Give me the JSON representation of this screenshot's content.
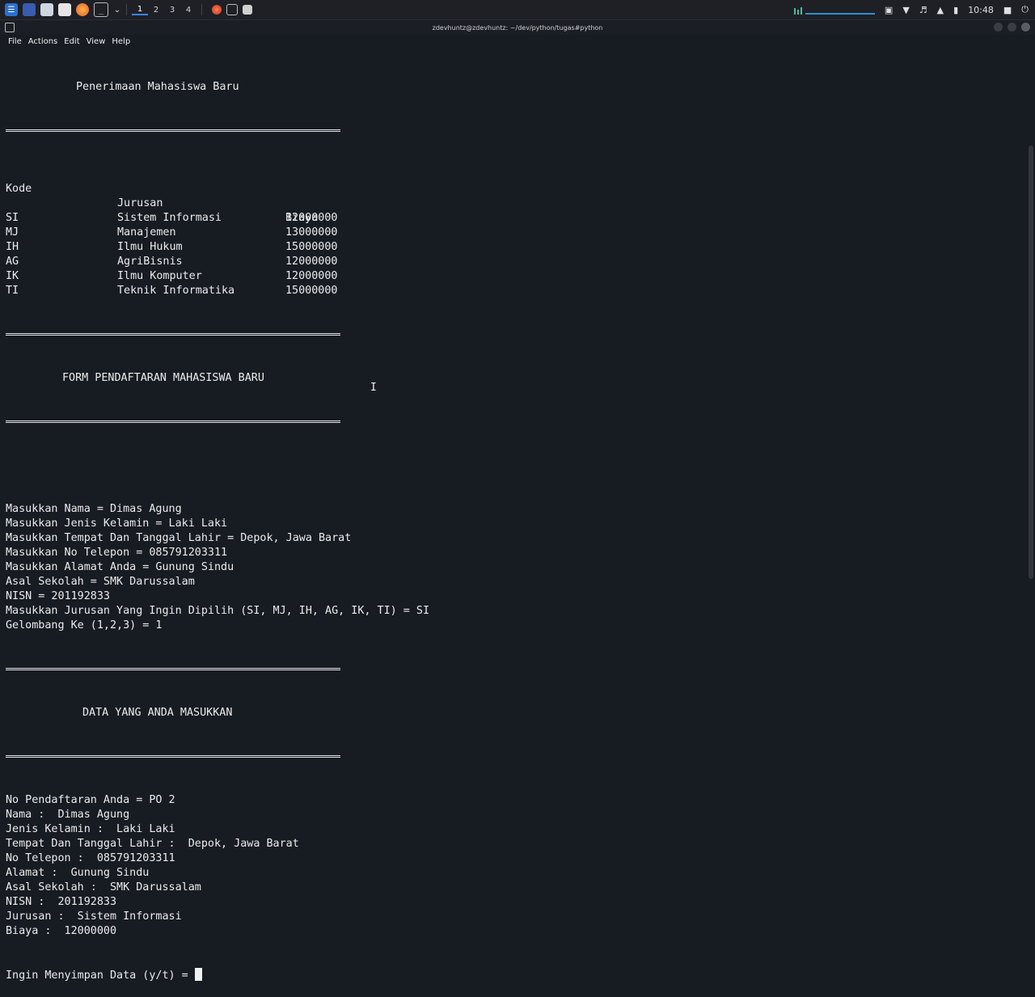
{
  "panel": {
    "workspaces": [
      "1",
      "2",
      "3",
      "4"
    ],
    "active_workspace": "1",
    "clock": "10:48",
    "icons": [
      "kali-menu-icon",
      "desktop-icon",
      "file-manager-icon",
      "text-editor-icon",
      "firefox-icon",
      "terminal-icon",
      "chevron-down-icon",
      "app-icon",
      "terminal-small-icon",
      "notes-icon",
      "network-graph-icon",
      "camera-icon",
      "network-icon",
      "volume-icon",
      "bell-icon",
      "battery-icon",
      "lock-icon",
      "power-icon"
    ]
  },
  "window": {
    "title": "zdevhuntz@zdevhuntz: ~/dev/python/tugas#python"
  },
  "menu": [
    "File",
    "Actions",
    "Edit",
    "View",
    "Help"
  ],
  "terminal": {
    "header_title": "Penerimaan Mahasiswa Baru",
    "table_headers": [
      "Kode",
      "Jurusan",
      "Biaya"
    ],
    "table_rows": [
      [
        "SI",
        "Sistem Informasi",
        "12000000"
      ],
      [
        "MJ",
        "Manajemen",
        "13000000"
      ],
      [
        "IH",
        "Ilmu Hukum",
        "15000000"
      ],
      [
        "AG",
        "AgriBisnis",
        "12000000"
      ],
      [
        "IK",
        "Ilmu Komputer",
        "12000000"
      ],
      [
        "TI",
        "Teknik Informatika",
        "15000000"
      ]
    ],
    "form_title": "FORM PENDAFTARAN MAHASISWA BARU",
    "form_lines": [
      "Masukkan Nama = Dimas Agung",
      "Masukkan Jenis Kelamin = Laki Laki",
      "Masukkan Tempat Dan Tanggal Lahir = Depok, Jawa Barat",
      "Masukkan No Telepon = 085791203311",
      "Masukkan Alamat Anda = Gunung Sindu",
      "Asal Sekolah = SMK Darussalam",
      "NISN = 201192833",
      "Masukkan Jurusan Yang Ingin Dipilih (SI, MJ, IH, AG, IK, TI) = SI",
      "Gelombang Ke (1,2,3) = 1"
    ],
    "data_title": "DATA YANG ANDA MASUKKAN",
    "data_lines": [
      "No Pendaftaran Anda = PO 2",
      "Nama :  Dimas Agung",
      "Jenis Kelamin :  Laki Laki",
      "Tempat Dan Tanggal Lahir :  Depok, Jawa Barat",
      "No Telepon :  085791203311",
      "Alamat :  Gunung Sindu",
      "Asal Sekolah :  SMK Darussalam",
      "NISN :  201192833",
      "Jurusan :  Sistem Informasi",
      "Biaya :  12000000"
    ],
    "prompt": "Ingin Menyimpan Data (y/t) = "
  },
  "colors": {
    "background": "#171b22",
    "text": "#ececec",
    "accent": "#2f8fd4"
  }
}
